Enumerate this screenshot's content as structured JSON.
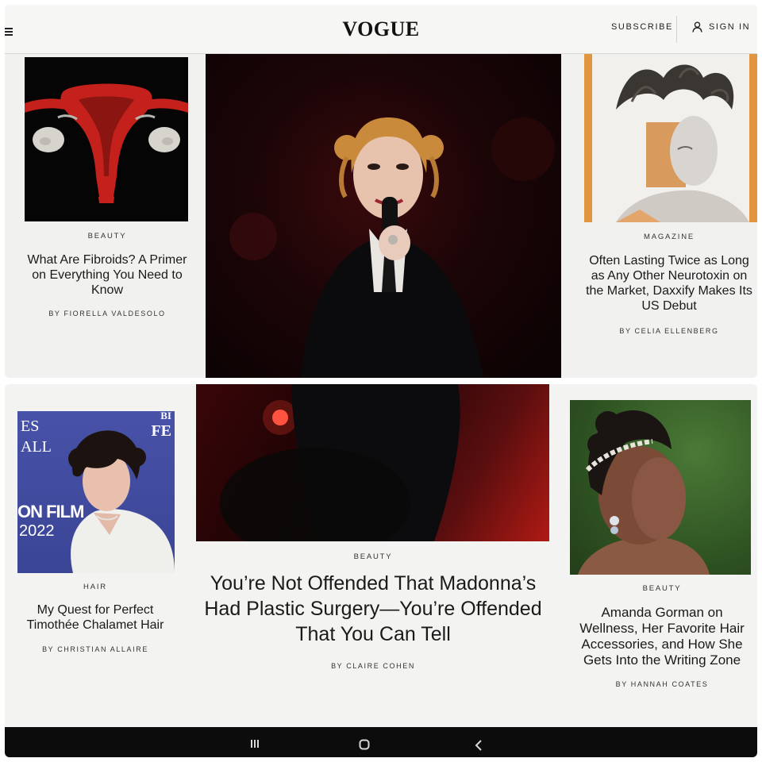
{
  "header": {
    "logo": "VOGUE",
    "subscribe_label": "SUBSCRIBE",
    "signin_label": "SIGN IN"
  },
  "top_articles": [
    {
      "rubric": "BEAUTY",
      "headline": "What Are Fibroids? A Primer on Everything You Need to Know",
      "byline": "BY FIORELLA VALDESOLO"
    },
    {
      "rubric": "MAGAZINE",
      "headline": "Often Lasting Twice as Long as Any Other Neurotoxin on the Market, Daxxify Makes Its US Debut",
      "byline": "BY CELIA ELLENBERG"
    }
  ],
  "bottom_articles": [
    {
      "rubric": "HAIR",
      "headline": "My Quest for Perfect Timothée Chalamet Hair",
      "byline": "BY CHRISTIAN ALLAIRE"
    },
    {
      "rubric": "BEAUTY",
      "headline": "You’re Not Offended That Madonna’s Had Plastic Surgery—You’re Offended That You Can Tell",
      "byline": "BY CLAIRE COHEN"
    },
    {
      "rubric": "BEAUTY",
      "headline": "Amanda Gorman on Wellness, Her Favorite Hair Accessories, and How She Gets Into the Writing Zone",
      "byline": "BY HANNAH COATES"
    }
  ],
  "backdrop_text": {
    "line1": "ES",
    "line2": "ALL",
    "corner1": "BI",
    "corner2": "FE",
    "film": "ON FILM",
    "year": "2022"
  },
  "icons": {
    "signin": "user-icon",
    "menu": "hamburger-icon",
    "nav_recents": "recents-icon",
    "nav_home": "home-icon",
    "nav_back": "back-icon"
  },
  "colors": {
    "page_bg": "#f1f2f0",
    "text": "#1a1a1a",
    "dark_photo": "#140608",
    "uterus_red": "#c4211c",
    "navbar": "#0c0c0c"
  }
}
